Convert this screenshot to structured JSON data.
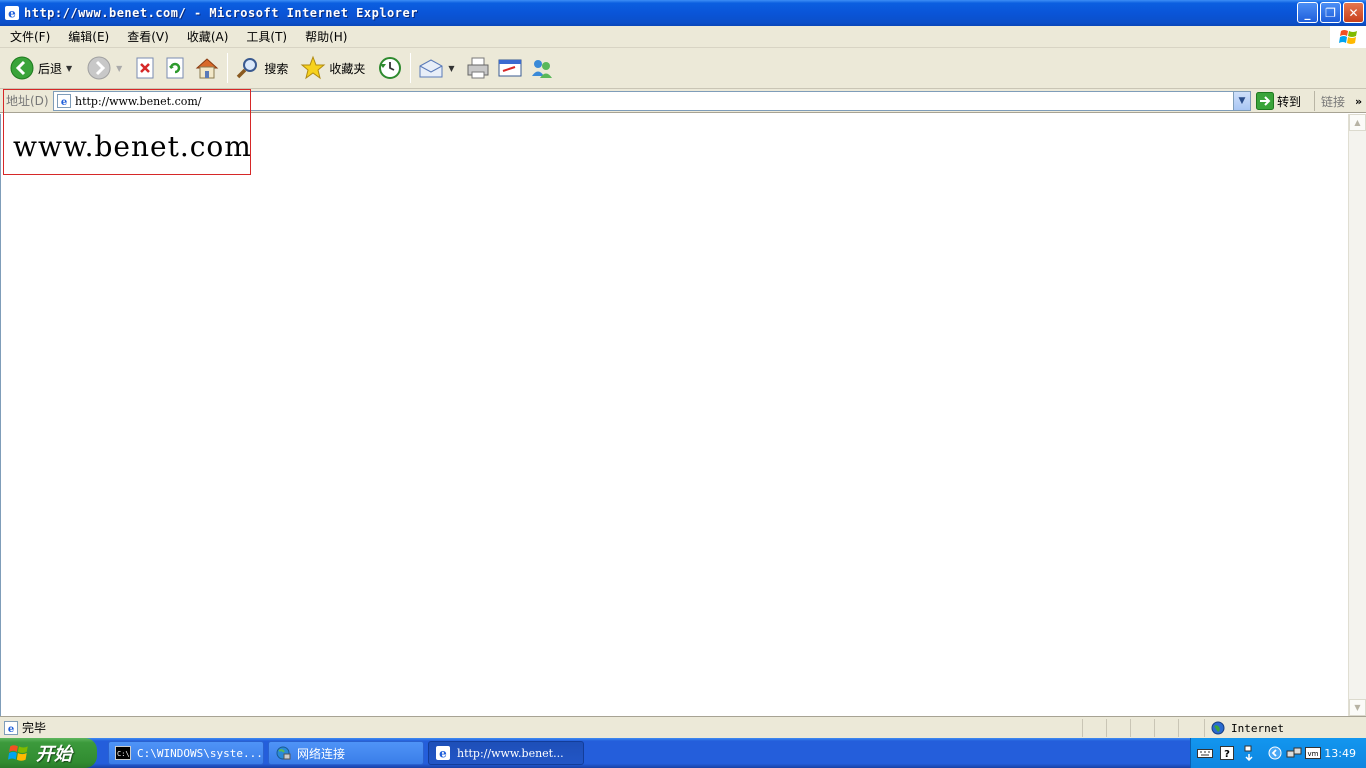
{
  "window": {
    "title": "http://www.benet.com/ - Microsoft Internet Explorer",
    "controls": {
      "minimize": "_",
      "restore": "❐",
      "close": "✕"
    }
  },
  "menu": {
    "items": [
      {
        "label": "文件(F)"
      },
      {
        "label": "编辑(E)"
      },
      {
        "label": "查看(V)"
      },
      {
        "label": "收藏(A)"
      },
      {
        "label": "工具(T)"
      },
      {
        "label": "帮助(H)"
      }
    ]
  },
  "toolbar": {
    "back_label": "后退",
    "search_label": "搜索",
    "favorites_label": "收藏夹"
  },
  "address": {
    "label": "地址(D)",
    "value": "http://www.benet.com/",
    "go_label": "转到",
    "links_label": "链接",
    "links_more": "»"
  },
  "page": {
    "text": "www.benet.com"
  },
  "status": {
    "text": "完毕",
    "zone": "Internet"
  },
  "taskbar": {
    "start_label": "开始",
    "tasks": [
      {
        "label": "C:\\WINDOWS\\syste..."
      },
      {
        "label": "网络连接"
      },
      {
        "label": "http://www.benet..."
      }
    ],
    "clock": "13:49"
  },
  "colors": {
    "titlebar": "#0a55d8",
    "chrome": "#ece9d8",
    "highlight": "#d62828",
    "start": "#318c31",
    "taskbar": "#245edb"
  }
}
